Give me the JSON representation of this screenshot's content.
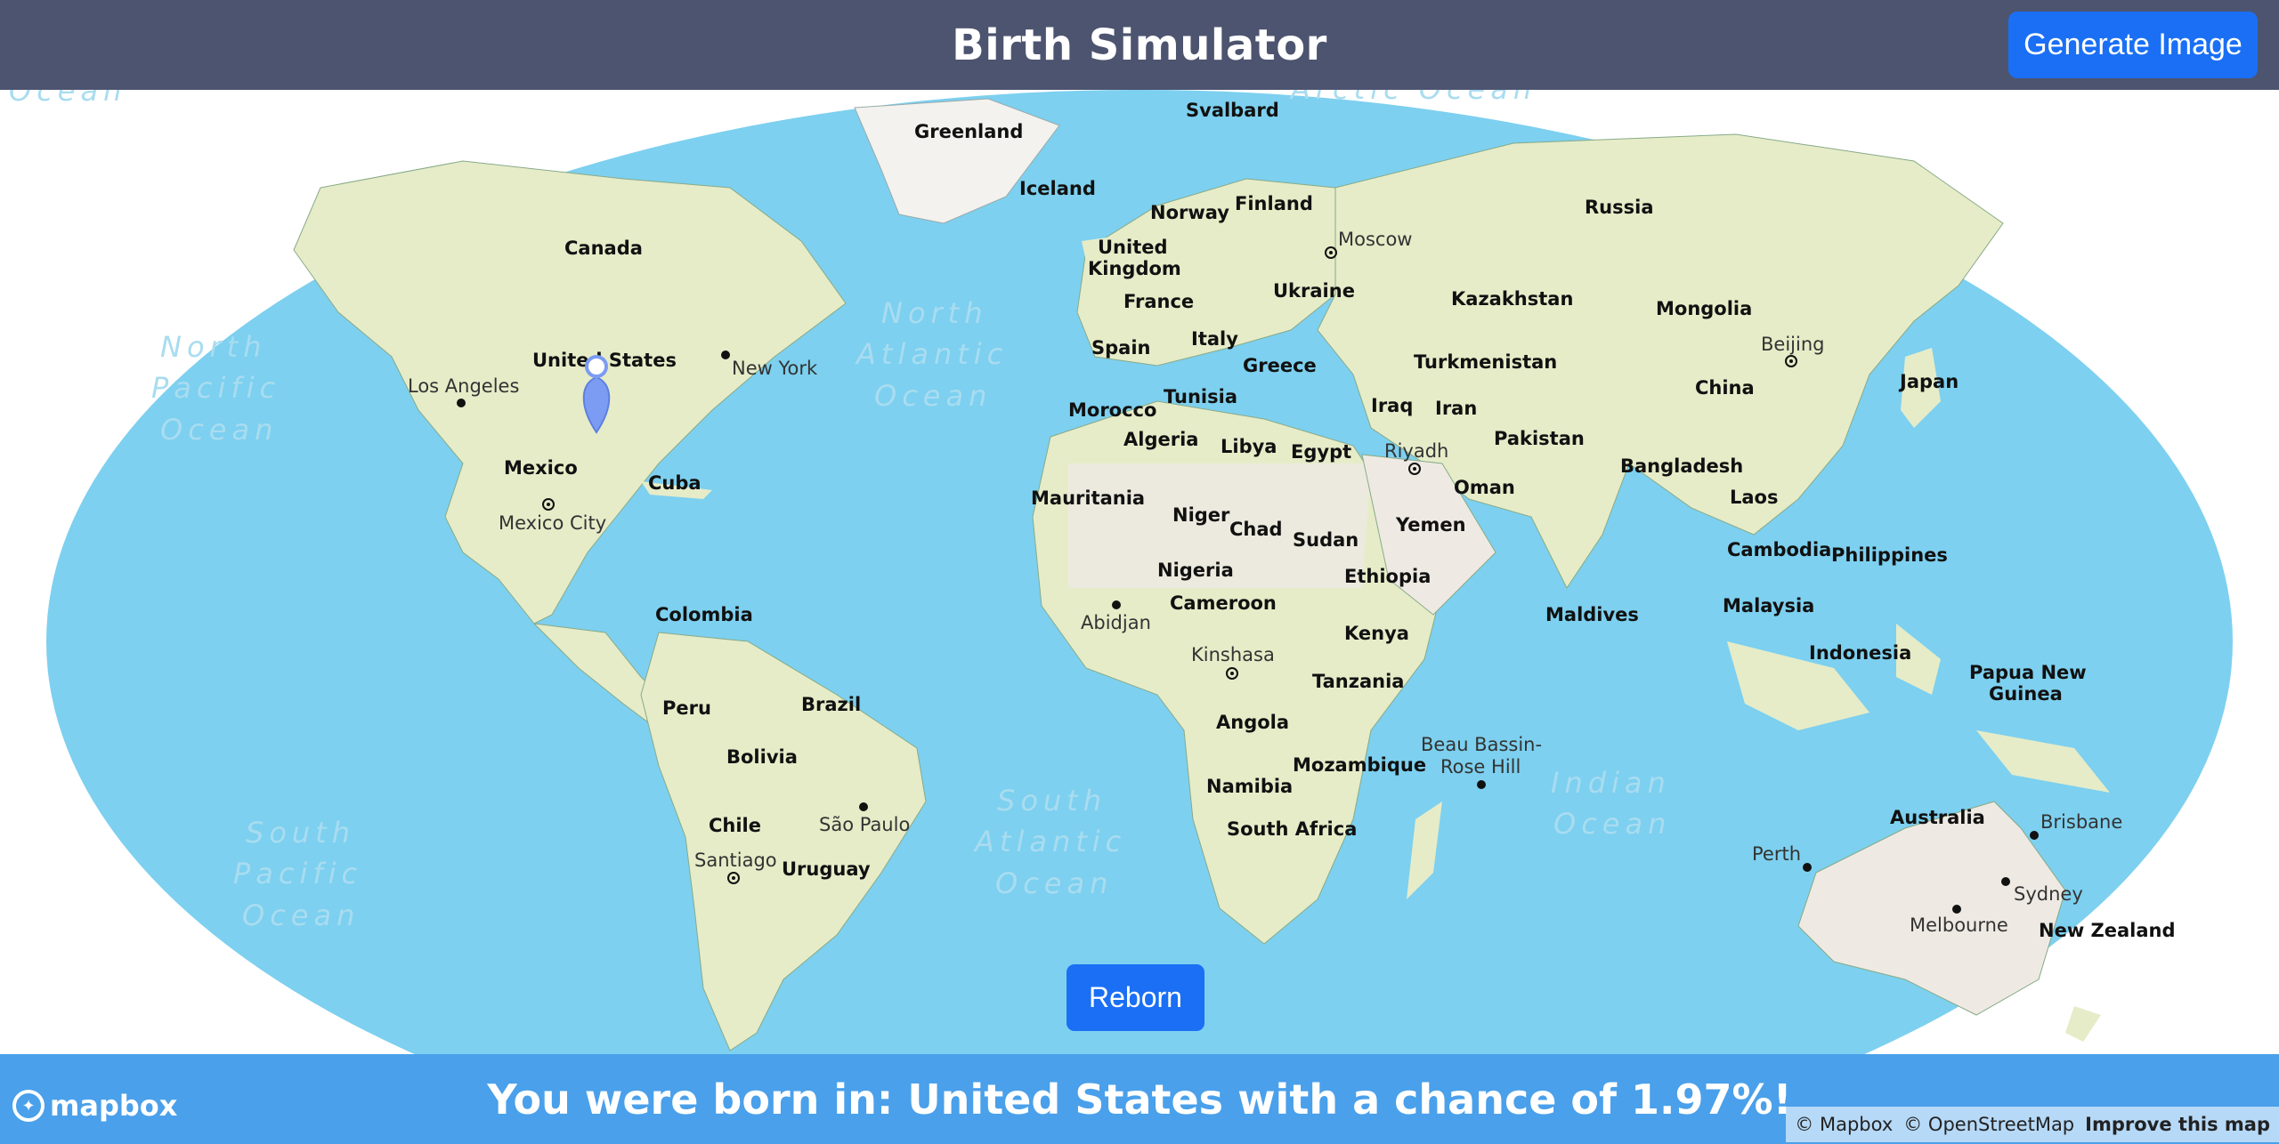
{
  "header": {
    "title": "Birth Simulator",
    "generate_button": "Generate Image"
  },
  "map": {
    "countries": [
      "Greenland",
      "Iceland",
      "Canada",
      "United States",
      "Mexico",
      "Cuba",
      "Colombia",
      "Peru",
      "Brazil",
      "Bolivia",
      "Chile",
      "Uruguay",
      "Russia",
      "Finland",
      "Norway",
      "United Kingdom",
      "France",
      "Spain",
      "Italy",
      "Ukraine",
      "Greece",
      "Kazakhstan",
      "Mongolia",
      "Turkmenistan",
      "China",
      "Japan",
      "Iraq",
      "Iran",
      "Pakistan",
      "Bangladesh",
      "Laos",
      "Cambodia",
      "Philippines",
      "Malaysia",
      "Indonesia",
      "Papua New Guinea",
      "Maldives",
      "Oman",
      "Yemen",
      "Morocco",
      "Tunisia",
      "Algeria",
      "Libya",
      "Egypt",
      "Mauritania",
      "Niger",
      "Chad",
      "Sudan",
      "Nigeria",
      "Ethiopia",
      "Cameroon",
      "Kenya",
      "Tanzania",
      "Angola",
      "Mozambique",
      "Namibia",
      "South Africa",
      "Australia",
      "New Zealand",
      "Svalbard"
    ],
    "cities": [
      "Los Angeles",
      "New York",
      "Mexico City",
      "São Paulo",
      "Santiago",
      "Moscow",
      "Riyadh",
      "Beijing",
      "Abidjan",
      "Kinshasa",
      "Beau Bassin-Rose Hill",
      "Perth",
      "Brisbane",
      "Sydney",
      "Melbourne"
    ],
    "oceans": [
      "North Pacific Ocean",
      "North Atlantic Ocean",
      "South Atlantic Ocean",
      "South Pacific Ocean",
      "Indian Ocean",
      "Arctic Ocean",
      "Ocean"
    ],
    "marker": "location-pin-icon",
    "colors": {
      "water": "#7dd0ef",
      "land": "#e6ecc8",
      "desert": "#eeeae3",
      "marker": "#7b9cf2"
    }
  },
  "reborn_button": "Reborn",
  "result": {
    "text": "You were born in: United States with a chance of 1.97%!"
  },
  "attribution": {
    "logo": "mapbox",
    "mapbox": "© Mapbox",
    "osm": "© OpenStreetMap",
    "improve": "Improve this map"
  }
}
